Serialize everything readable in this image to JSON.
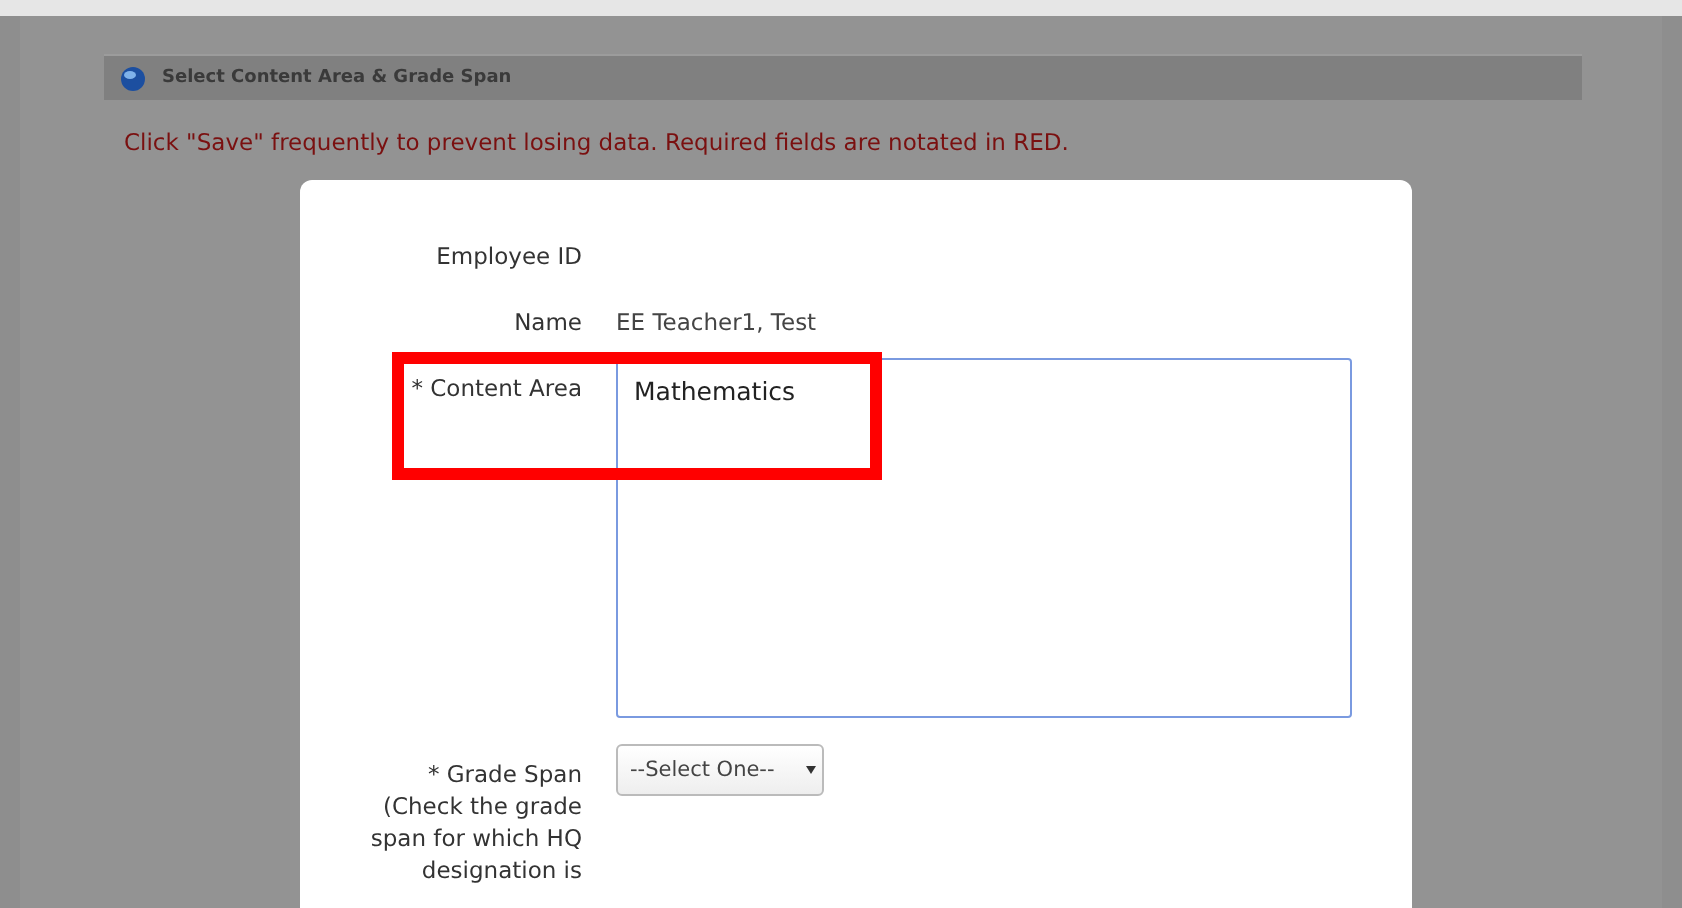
{
  "panel": {
    "title": "Select Content Area & Grade Span"
  },
  "notice": "Click \"Save\" frequently to prevent losing data. Required fields are notated in RED.",
  "fields": [
    {
      "kind": "static",
      "label": [
        "Employee ID"
      ]
    },
    {
      "kind": "static",
      "label": [
        "Name"
      ],
      "value": "EE Teacher1, Test"
    },
    {
      "kind": "textarea",
      "label": [
        "* Content Area"
      ],
      "value": "Mathematics",
      "highlighted": true
    },
    {
      "kind": "select",
      "label": [
        "* Grade Span",
        "(Check the grade",
        "span for which HQ",
        "designation is"
      ],
      "value": "--Select One--"
    }
  ]
}
